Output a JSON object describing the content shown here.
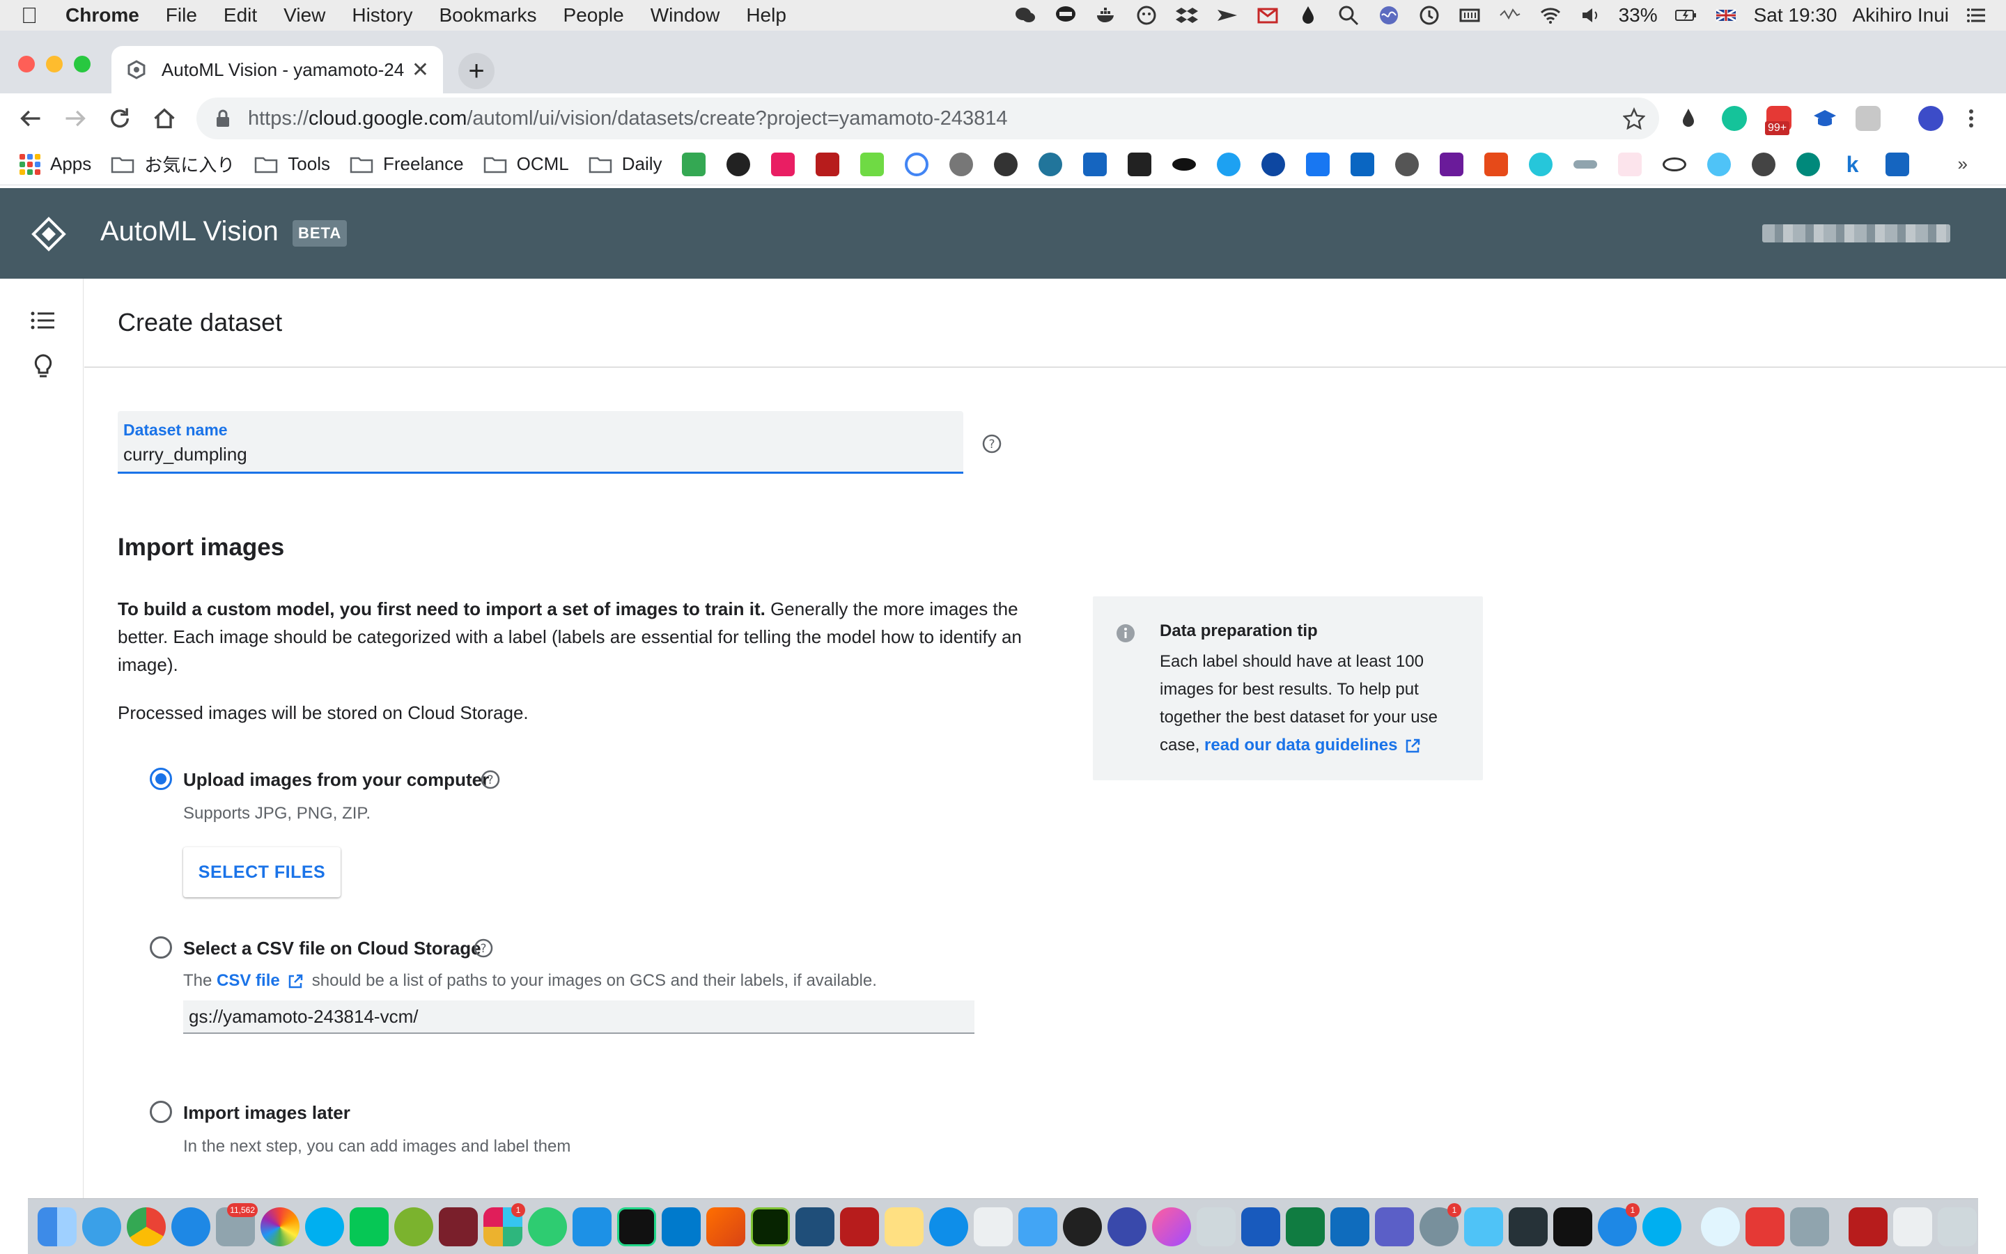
{
  "menubar": {
    "items": [
      "Chrome",
      "File",
      "Edit",
      "View",
      "History",
      "Bookmarks",
      "People",
      "Window",
      "Help"
    ],
    "battery": "33%",
    "clock": "Sat 19:30",
    "user": "Akihiro Inui"
  },
  "browser": {
    "tab_title": "AutoML Vision - yamamoto-24",
    "url_scheme": "https://",
    "url_host": "cloud.google.com",
    "url_path": "/automl/ui/vision/datasets/create?project=yamamoto-243814",
    "extension_badge": "99+"
  },
  "bookmarks": {
    "apps": "Apps",
    "folders": [
      "お気に入り",
      "Tools",
      "Freelance",
      "OCML",
      "Daily"
    ]
  },
  "app": {
    "title": "AutoML Vision",
    "badge": "BETA"
  },
  "page": {
    "title": "Create dataset",
    "dataset_name_label": "Dataset name",
    "dataset_name_value": "curry_dumpling",
    "import_title": "Import images",
    "import_desc_bold": "To build a custom model, you first need to import a set of images to train it.",
    "import_desc_rest": " Generally the more images the better. Each image should be categorized with a label (labels are essential for telling the model how to identify an image).",
    "stored_text": "Processed images will be stored on Cloud Storage.",
    "option_upload": "Upload images from your computer",
    "option_upload_sub": "Supports JPG, PNG, ZIP.",
    "select_files": "SELECT FILES",
    "option_csv": "Select a CSV file on Cloud Storage",
    "csv_sub_prefix": "The ",
    "csv_sub_link": "CSV file",
    "csv_sub_suffix": "should be a list of paths to your images on GCS and their labels, if available.",
    "csv_value": "gs://yamamoto-243814-vcm/",
    "option_later": "Import images later",
    "option_later_sub": "In the next step, you can add images and label them"
  },
  "tip": {
    "title": "Data preparation tip",
    "body": "Each label should have at least 100 images for best results. To help put together the best dataset for your use case, ",
    "link": "read our data guidelines"
  },
  "dock": {
    "badges": [
      "11,562",
      "1",
      "1",
      "1"
    ]
  },
  "colors": {
    "header": "#455a64",
    "accent": "#1a73e8"
  }
}
